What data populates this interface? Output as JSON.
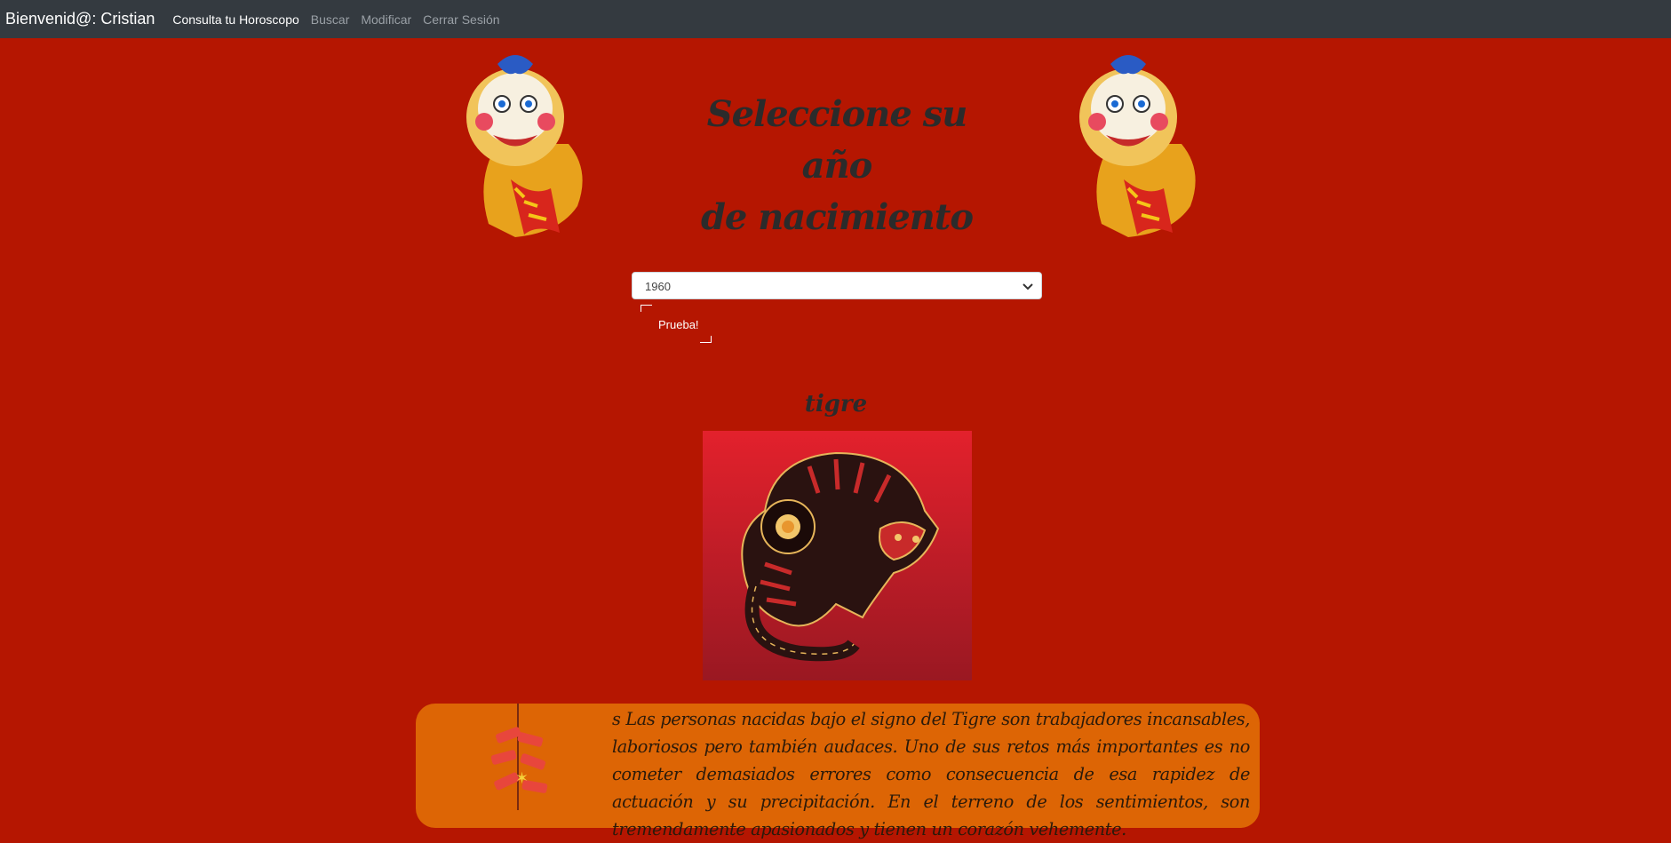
{
  "navbar": {
    "brand": "Bienvenid@: Cristian",
    "links": [
      {
        "label": "Consulta tu Horoscopo",
        "active": true
      },
      {
        "label": "Buscar",
        "active": false
      },
      {
        "label": "Modificar",
        "active": false
      },
      {
        "label": "Cerrar Sesión",
        "active": false
      }
    ]
  },
  "main": {
    "heading_line1": "Seleccione su año",
    "heading_line2": "de nacimiento",
    "year_select": {
      "value": "1960"
    },
    "submit_label": "Prueba!"
  },
  "result": {
    "sign_name": "tigre",
    "description": "s Las personas nacidas bajo el signo del Tigre son trabajadores incansables, laboriosos pero también audaces. Uno de sus retos más importantes es no cometer demasiados errores como consecuencia de esa rapidez de actuación y su precipitación. En el terreno de los sentimientos, son tremendamente apasionados y tienen un corazón vehemente."
  },
  "colors": {
    "page_background": "#b51601",
    "navbar": "#343a40",
    "card": "#dd6505",
    "text_dark": "#2b2b2b"
  }
}
